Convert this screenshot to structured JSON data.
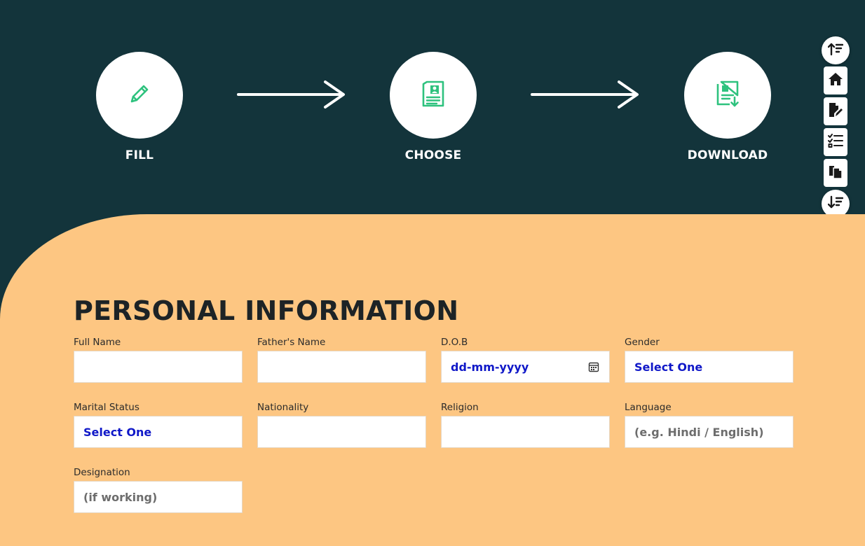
{
  "steps": [
    {
      "label": "FILL",
      "icon": "pencil-icon"
    },
    {
      "label": "CHOOSE",
      "icon": "resume-document-icon"
    },
    {
      "label": "DOWNLOAD",
      "icon": "download-document-icon"
    }
  ],
  "colors": {
    "header_bg": "#13343b",
    "panel_bg": "#fdc682",
    "step_icon": "#2ec27e",
    "placeholder_blue": "#1018c8"
  },
  "toolbar": {
    "items": [
      "sort-up-icon",
      "home-icon",
      "edit-document-icon",
      "checklist-icon",
      "copy-documents-icon",
      "sort-down-icon"
    ]
  },
  "form": {
    "title": "PERSONAL INFORMATION",
    "fields": {
      "full_name": {
        "label": "Full Name",
        "value": ""
      },
      "fathers_name": {
        "label": "Father's Name",
        "value": ""
      },
      "dob": {
        "label": "D.O.B",
        "value": "dd-mm-yyyy"
      },
      "gender": {
        "label": "Gender",
        "value": "Select One"
      },
      "marital_status": {
        "label": "Marital Status",
        "value": "Select One"
      },
      "nationality": {
        "label": "Nationality",
        "value": ""
      },
      "religion": {
        "label": "Religion",
        "value": ""
      },
      "language": {
        "label": "Language",
        "placeholder": "(e.g. Hindi / English)"
      },
      "designation": {
        "label": "Designation",
        "placeholder": "(if working)"
      }
    }
  }
}
